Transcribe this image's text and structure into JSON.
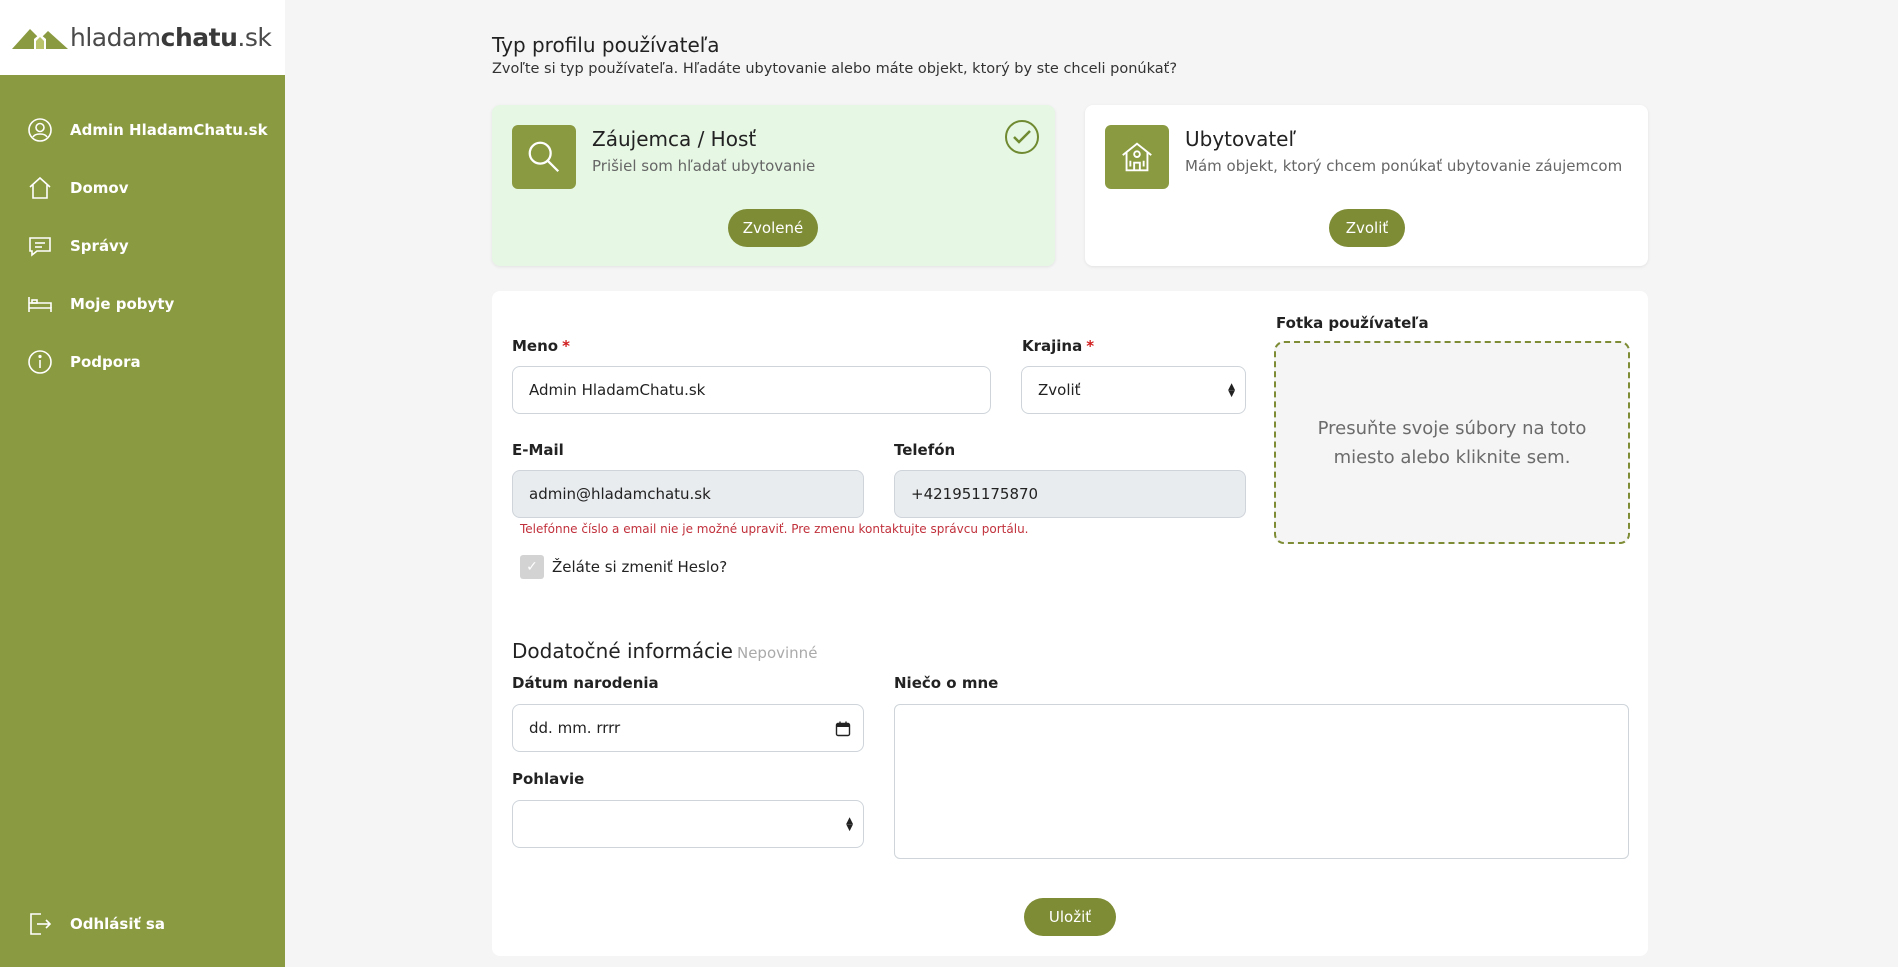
{
  "brand": {
    "logo_light": "hladam",
    "logo_bold": "chatu",
    "logo_suffix": ".sk"
  },
  "sidebar": {
    "items": [
      {
        "label": "Admin HladamChatu.sk",
        "icon": "user-circle-icon"
      },
      {
        "label": "Domov",
        "icon": "home-icon"
      },
      {
        "label": "Správy",
        "icon": "message-icon"
      },
      {
        "label": "Moje pobyty",
        "icon": "bed-icon"
      },
      {
        "label": "Podpora",
        "icon": "info-icon"
      }
    ],
    "logout_label": "Odhlásiť sa"
  },
  "profile_type": {
    "title": "Typ profilu používateľa",
    "subtitle": "Zvoľte si typ používateľa. Hľadáte ubytovanie alebo máte objekt, ktorý by ste chceli ponúkať?",
    "options": [
      {
        "title": "Záujemca / Hosť",
        "description": "Prišiel som hľadať ubytovanie",
        "button": "Zvolené",
        "selected": true
      },
      {
        "title": "Ubytovateľ",
        "description": "Mám objekt, ktorý chcem ponúkať ubytovanie záujemcom",
        "button": "Zvoliť",
        "selected": false
      }
    ]
  },
  "form": {
    "name_label": "Meno",
    "name_value": "Admin HladamChatu.sk",
    "country_label": "Krajina",
    "country_value": "Zvoliť",
    "required_mark": "*",
    "email_label": "E-Mail",
    "email_value": "admin@hladamchatu.sk",
    "phone_label": "Telefón",
    "phone_value": "+421951175870",
    "readonly_hint": "Telefónne číslo a email nie je možné upraviť. Pre zmenu kontaktujte správcu portálu.",
    "change_password_label": "Želáte si zmeniť Heslo?",
    "photo_label": "Fotka používateľa",
    "photo_dropzone": "Presuňte svoje súbory na toto miesto alebo kliknite sem.",
    "extra_title": "Dodatočné informácie",
    "extra_optional": "Nepovinné",
    "birthdate_label": "Dátum narodenia",
    "birthdate_placeholder": "dd. mm. rrrr",
    "gender_label": "Pohlavie",
    "gender_value": "",
    "about_label": "Niečo o mne",
    "about_value": "",
    "save_button": "Uložiť"
  },
  "colors": {
    "accent": "#8a9a40",
    "button": "#7d8c35",
    "selected_card": "#e6f7e4",
    "error": "#c1313c"
  }
}
